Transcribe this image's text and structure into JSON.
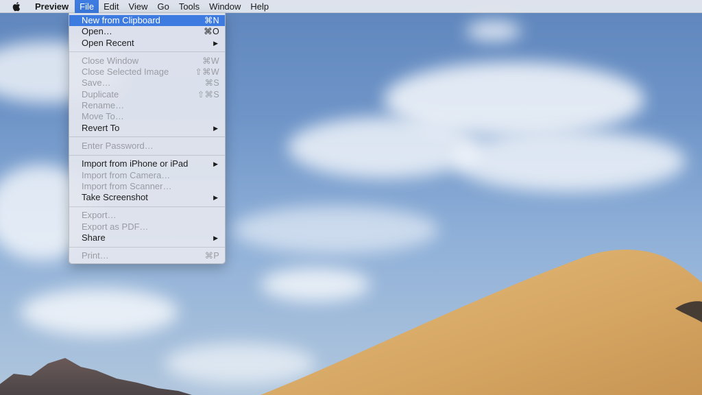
{
  "menubar": {
    "app_name": "Preview",
    "menus": [
      "File",
      "Edit",
      "View",
      "Go",
      "Tools",
      "Window",
      "Help"
    ],
    "active_menu": "File"
  },
  "file_menu": {
    "groups": [
      [
        {
          "label": "New from Clipboard",
          "shortcut": "⌘N",
          "enabled": true,
          "highlighted": true
        },
        {
          "label": "Open…",
          "shortcut": "⌘O",
          "enabled": true
        },
        {
          "label": "Open Recent",
          "submenu": true,
          "enabled": true
        }
      ],
      [
        {
          "label": "Close Window",
          "shortcut": "⌘W",
          "enabled": false
        },
        {
          "label": "Close Selected Image",
          "shortcut": "⇧⌘W",
          "enabled": false
        },
        {
          "label": "Save…",
          "shortcut": "⌘S",
          "enabled": false
        },
        {
          "label": "Duplicate",
          "shortcut": "⇧⌘S",
          "enabled": false
        },
        {
          "label": "Rename…",
          "enabled": false
        },
        {
          "label": "Move To…",
          "enabled": false
        },
        {
          "label": "Revert To",
          "submenu": true,
          "enabled": true
        }
      ],
      [
        {
          "label": "Enter Password…",
          "enabled": false
        }
      ],
      [
        {
          "label": "Import from iPhone or iPad",
          "submenu": true,
          "enabled": true
        },
        {
          "label": "Import from Camera…",
          "enabled": false
        },
        {
          "label": "Import from Scanner…",
          "enabled": false
        },
        {
          "label": "Take Screenshot",
          "submenu": true,
          "enabled": true
        }
      ],
      [
        {
          "label": "Export…",
          "enabled": false
        },
        {
          "label": "Export as PDF…",
          "enabled": false
        },
        {
          "label": "Share",
          "submenu": true,
          "enabled": true
        }
      ],
      [
        {
          "label": "Print…",
          "shortcut": "⌘P",
          "enabled": false
        }
      ]
    ]
  },
  "icons": {
    "apple": "apple-icon",
    "submenu": "chevron-right-icon"
  },
  "colors": {
    "highlight": "#3d7be0",
    "menubar_bg": "#e8eaf0",
    "disabled_text": "#9a9ca3",
    "sky": "#6f95c8",
    "dune": "#d9ad6c"
  }
}
